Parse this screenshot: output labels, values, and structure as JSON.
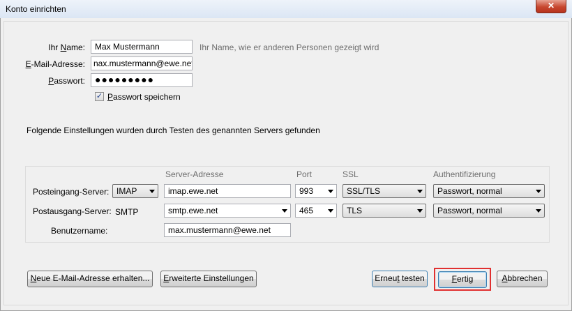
{
  "window": {
    "title": "Konto einrichten",
    "close_glyph": "✕"
  },
  "form": {
    "name_label_pre": "Ihr ",
    "name_label_u": "N",
    "name_label_post": "ame:",
    "name_value": "Max Mustermann",
    "name_hint": "Ihr Name, wie er anderen Personen gezeigt wird",
    "email_label_u": "E",
    "email_label_post": "-Mail-Adresse:",
    "email_value": "nax.mustermann@ewe.net",
    "password_label_u": "P",
    "password_label_post": "asswort:",
    "password_value": "●●●●●●●●●",
    "save_password_checked": true,
    "save_password_label_u": "P",
    "save_password_label_post": "asswort speichern"
  },
  "status_text": "Folgende Einstellungen wurden durch Testen des genannten Servers gefunden",
  "server": {
    "headers": {
      "address": "Server-Adresse",
      "port": "Port",
      "ssl": "SSL",
      "auth": "Authentifizierung"
    },
    "incoming": {
      "label": "Posteingang-Server:",
      "protocol": "IMAP",
      "host": "imap.ewe.net",
      "port": "993",
      "ssl": "SSL/TLS",
      "auth": "Passwort, normal"
    },
    "outgoing": {
      "label": "Postausgang-Server:",
      "protocol": "SMTP",
      "host": "smtp.ewe.net",
      "port": "465",
      "ssl": "TLS",
      "auth": "Passwort, normal"
    },
    "username_label": "Benutzername:",
    "username_value": "max.mustermann@ewe.net"
  },
  "buttons": {
    "new_address_u": "N",
    "new_address_post": "eue E-Mail-Adresse erhalten...",
    "advanced_u": "E",
    "advanced_post": "rweiterte Einstellungen",
    "retest_pre": "Erneu",
    "retest_u": "t",
    "retest_post": " testen",
    "done_u": "F",
    "done_post": "ertig",
    "cancel_u": "A",
    "cancel_post": "bbrechen"
  },
  "colors": {
    "highlight": "#e03030",
    "close_button": "#c7472f"
  }
}
